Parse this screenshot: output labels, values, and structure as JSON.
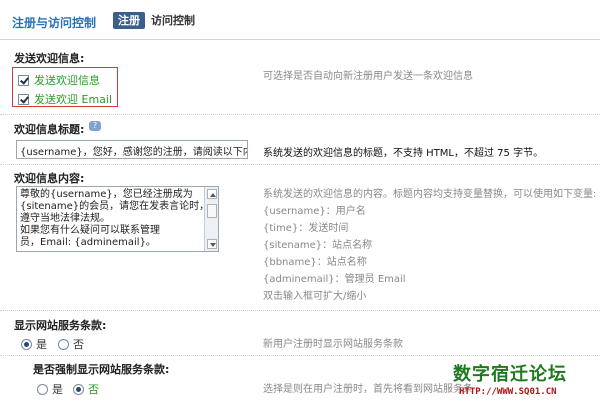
{
  "header": {
    "title": "注册与访问控制",
    "tabs": [
      {
        "label": "注册",
        "active": true
      },
      {
        "label": "访问控制",
        "active": false
      }
    ]
  },
  "welcome_send": {
    "label": "发送欢迎信息:",
    "options": [
      {
        "label": "发送欢迎信息",
        "checked": true
      },
      {
        "label": "发送欢迎 Email",
        "checked": true
      }
    ],
    "description": "可选择是否自动向新注册用户发送一条欢迎信息"
  },
  "welcome_title": {
    "label": "欢迎信息标题:",
    "value": "{username}，您好，感谢您的注册，请阅读以下内容。",
    "description": "系统发送的欢迎信息的标题，不支持 HTML，不超过 75 字节。"
  },
  "welcome_content": {
    "label": "欢迎信息内容:",
    "lines": [
      "尊敬的{username}，您已经注册成为",
      "{sitename}的会员，请您在发表言论时，",
      "遵守当地法律法规。",
      "如果您有什么疑问可以联系管理",
      "员，Email: {adminemail}。"
    ],
    "description_lines": [
      "系统发送的欢迎信息的内容。标题内容均支持变量替换，可以使用如下变量:",
      "{username}：用户名",
      "{time}：发送时间",
      "{sitename}：站点名称",
      "{bbname}：站点名称",
      "{adminemail}：管理员 Email",
      "双击输入框可扩大/缩小"
    ]
  },
  "show_terms": {
    "label": "显示网站服务条款:",
    "yes": "是",
    "no": "否",
    "selected": "yes",
    "description": "新用户注册时显示网站服务条款"
  },
  "force_terms": {
    "label": "是否强制显示网站服务条款:",
    "yes": "是",
    "no": "否",
    "selected": "no",
    "description": "选择是则在用户注册时，首先将看到网站服务条"
  },
  "watermark": {
    "name": "数字宿迁论坛",
    "url": "HTTP://WWW.SQ01.CN"
  },
  "colors": {
    "accent": "#2b72b5",
    "active_tab": "#3a5f8a",
    "green_text": "#2a9a2a",
    "highlight_border": "#d23b3b"
  }
}
